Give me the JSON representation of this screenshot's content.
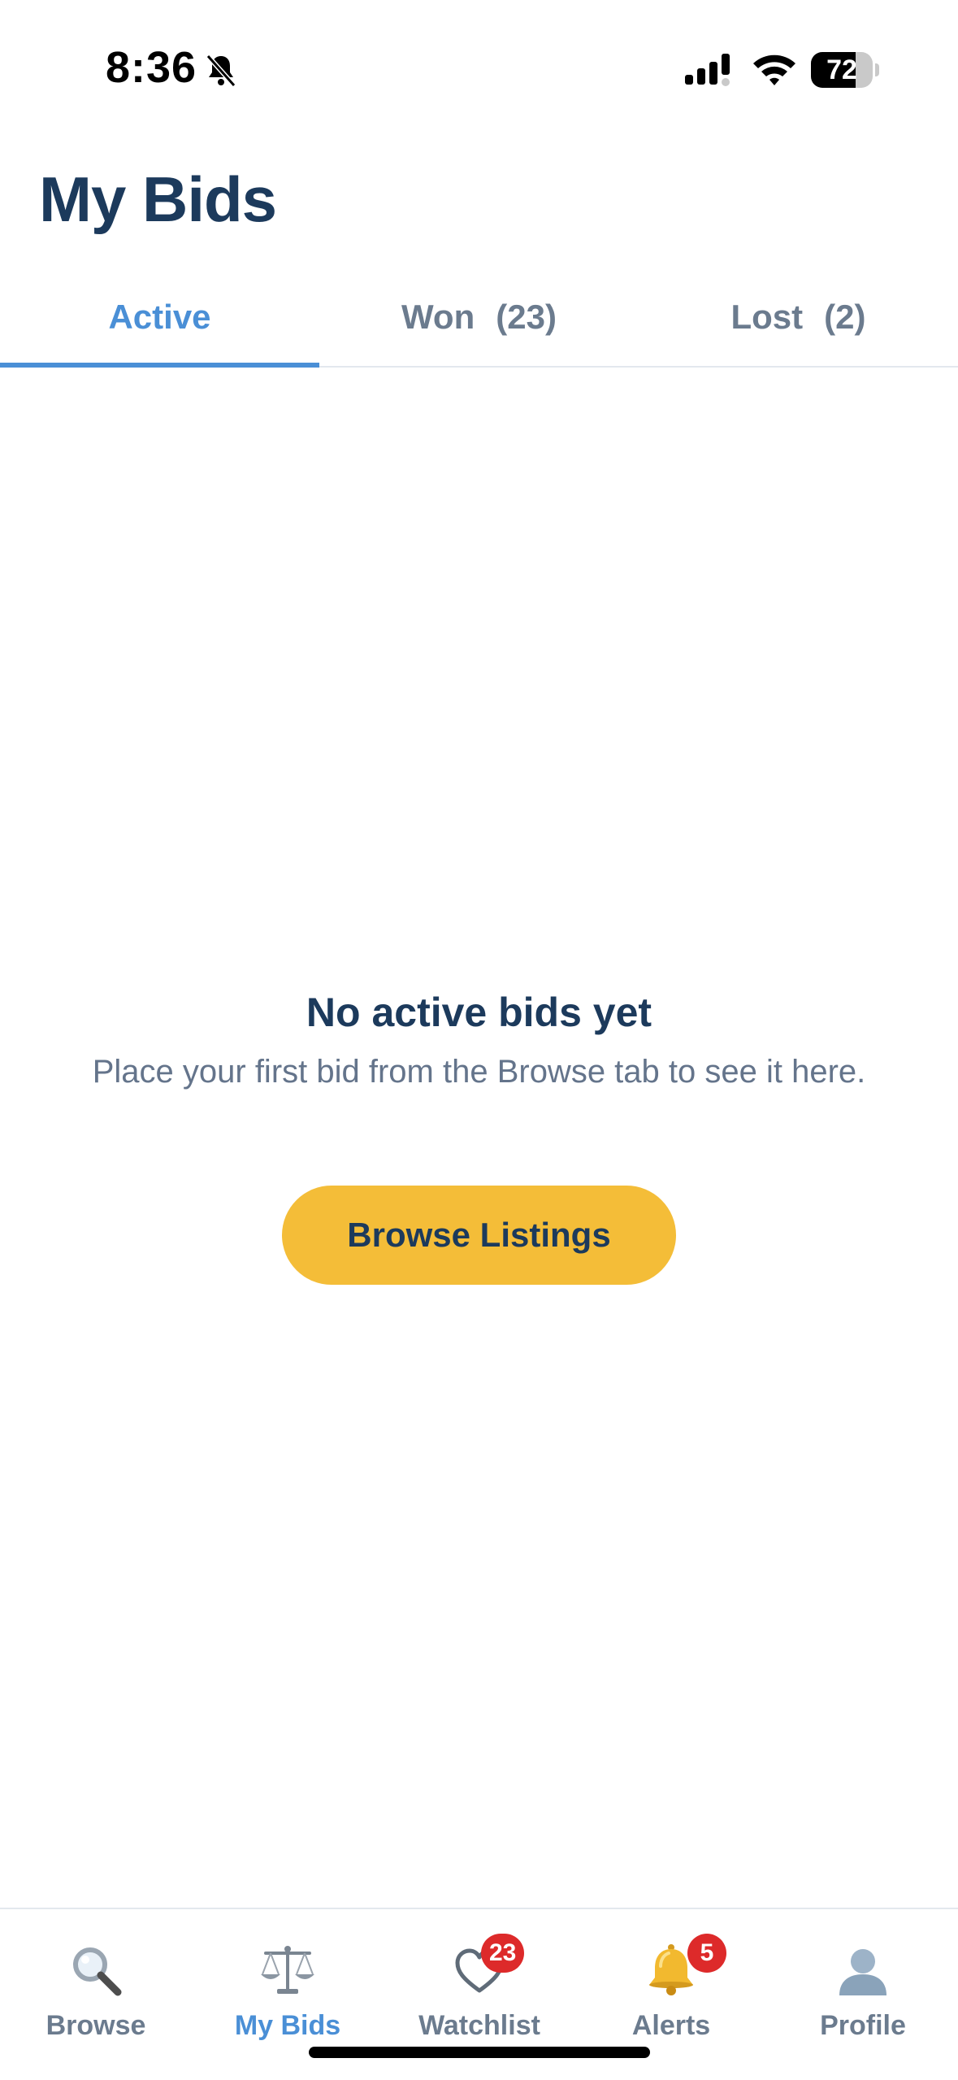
{
  "status_bar": {
    "time": "8:36",
    "battery_level": "72",
    "battery_fraction": 0.72
  },
  "header": {
    "title": "My Bids"
  },
  "tabs": [
    {
      "label": "Active",
      "count": "",
      "active": true
    },
    {
      "label": "Won",
      "count": "(23)",
      "active": false
    },
    {
      "label": "Lost",
      "count": "(2)",
      "active": false
    }
  ],
  "empty_state": {
    "title": "No active bids yet",
    "description": "Place your first bid from the Browse tab to see it here.",
    "button_label": "Browse Listings"
  },
  "tab_bar": {
    "items": [
      {
        "label": "Browse",
        "icon": "magnifying-glass-icon",
        "badge": "",
        "active": false
      },
      {
        "label": "My Bids",
        "icon": "balance-scale-icon",
        "badge": "",
        "active": true
      },
      {
        "label": "Watchlist",
        "icon": "heart-icon",
        "badge": "23",
        "active": false
      },
      {
        "label": "Alerts",
        "icon": "bell-icon",
        "badge": "5",
        "active": false
      },
      {
        "label": "Profile",
        "icon": "person-icon",
        "badge": "",
        "active": false
      }
    ]
  },
  "colors": {
    "accent": "#4a8fd6",
    "navy": "#1c3a5c",
    "button": "#f4bd38",
    "badge": "#dd2a2a",
    "muted": "#6b7b8e"
  }
}
